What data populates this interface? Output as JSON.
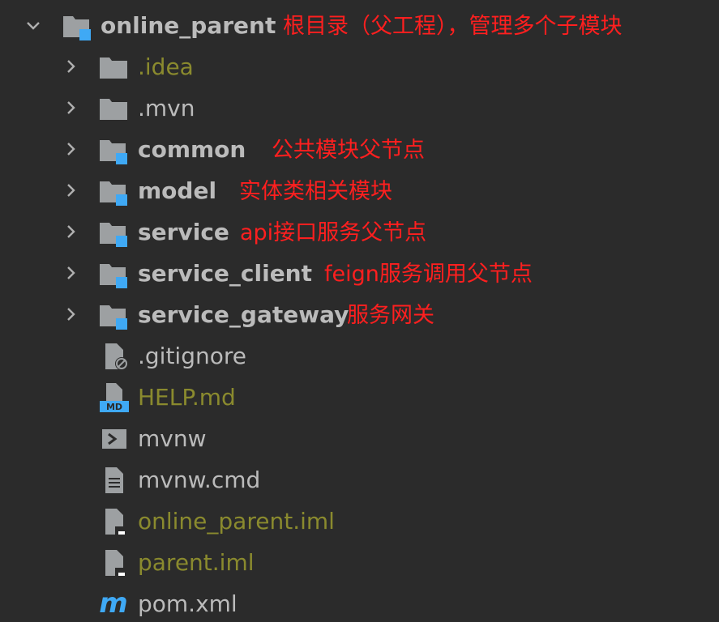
{
  "root": {
    "label": "online_parent",
    "annotation": "根目录（父工程），管理多个子模块",
    "chevron_icon": "chevron-down-icon",
    "icon": "module-folder-icon"
  },
  "items": [
    {
      "label": ".idea",
      "annotation": "",
      "icon": "folder-icon",
      "chevron_icon": "chevron-right-icon"
    },
    {
      "label": ".mvn",
      "annotation": "",
      "icon": "folder-icon",
      "chevron_icon": "chevron-right-icon"
    },
    {
      "label": "common",
      "annotation": "公共模块父节点",
      "icon": "module-folder-icon",
      "chevron_icon": "chevron-right-icon"
    },
    {
      "label": "model",
      "annotation": "实体类相关模块",
      "icon": "module-folder-icon",
      "chevron_icon": "chevron-right-icon"
    },
    {
      "label": "service",
      "annotation": "api接口服务父节点",
      "icon": "module-folder-icon",
      "chevron_icon": "chevron-right-icon"
    },
    {
      "label": "service_client",
      "annotation": "feign服务调用父节点",
      "icon": "module-folder-icon",
      "chevron_icon": "chevron-right-icon"
    },
    {
      "label": "service_gateway",
      "annotation": "服务网关",
      "icon": "module-folder-icon",
      "chevron_icon": "chevron-right-icon"
    },
    {
      "label": ".gitignore",
      "icon": "gitignore-file-icon"
    },
    {
      "label": "HELP.md",
      "icon": "markdown-file-icon",
      "icon_text": "MD"
    },
    {
      "label": "mvnw",
      "icon": "shell-script-icon"
    },
    {
      "label": "mvnw.cmd",
      "icon": "text-file-icon"
    },
    {
      "label": "online_parent.iml",
      "icon": "iml-file-icon"
    },
    {
      "label": "parent.iml",
      "icon": "iml-file-icon"
    },
    {
      "label": "pom.xml",
      "icon": "maven-pom-icon",
      "icon_text": "m"
    }
  ],
  "colors": {
    "background": "#2b2b2b",
    "text": "#bbbbbb",
    "ignored_text": "#8a8a2e",
    "annotation": "#ff1f1f",
    "module_badge": "#3fa9f5",
    "folder_gray": "#9da0a2"
  }
}
